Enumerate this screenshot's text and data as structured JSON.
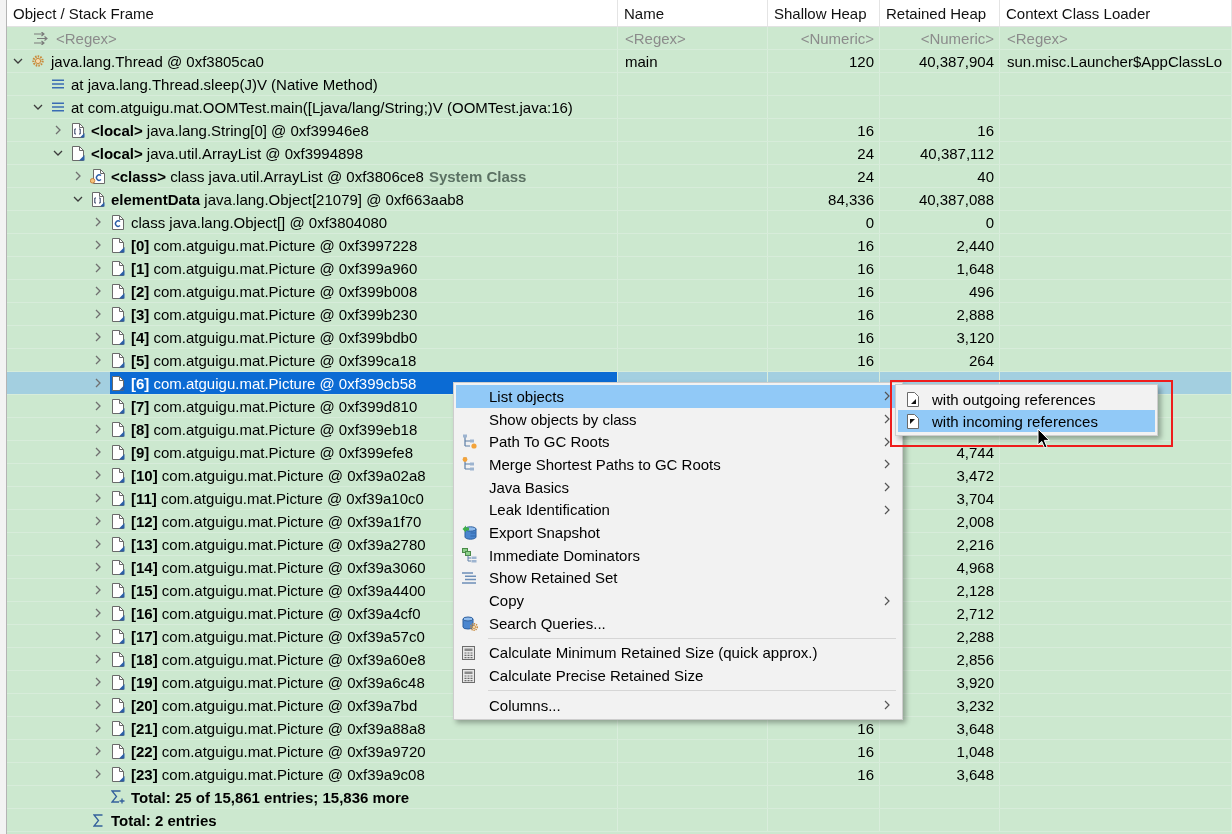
{
  "table": {
    "columns": [
      {
        "label": "Object / Stack Frame",
        "kind": "text",
        "filter": {
          "placeholder": "<Regex>"
        }
      },
      {
        "label": "Name",
        "kind": "text",
        "filter": {
          "placeholder": "<Regex>"
        }
      },
      {
        "label": "Shallow Heap",
        "kind": "numeric",
        "filter": {
          "placeholder": "<Numeric>"
        }
      },
      {
        "label": "Retained Heap",
        "kind": "numeric",
        "filter": {
          "placeholder": "<Numeric>"
        }
      },
      {
        "label": "Context Class Loader",
        "kind": "text",
        "filter": {
          "placeholder": "<Regex>"
        }
      }
    ],
    "rows": [
      {
        "kind": "thread",
        "text": "java.lang.Thread @ 0xf3805ca0",
        "name": "main",
        "shallow_heap": "120",
        "retained_heap": "40,387,904",
        "class_loader": "sun.misc.Launcher$AppClassLo",
        "expanded": true,
        "selected": false,
        "children": [
          {
            "kind": "frame",
            "text": "at java.lang.Thread.sleep(J)V (Native Method)",
            "selected": false
          },
          {
            "kind": "frame",
            "text": "at com.atguigu.mat.OOMTest.main([Ljava/lang/String;)V (OOMTest.java:16)",
            "expanded": true,
            "selected": false,
            "children": [
              {
                "kind": "array",
                "text": "**<local>** java.lang.String[0] @ 0xf39946e8",
                "shallow_heap": "16",
                "retained_heap": "16",
                "expanded": false,
                "selected": false
              },
              {
                "kind": "object",
                "text": "**<local>** java.util.ArrayList @ 0xf3994898",
                "shallow_heap": "24",
                "retained_heap": "40,387,112",
                "expanded": true,
                "selected": false,
                "children": [
                  {
                    "kind": "class_ref",
                    "text": "**<class>** class java.util.ArrayList @ 0xf3806ce8",
                    "note": "System Class",
                    "shallow_heap": "24",
                    "retained_heap": "40",
                    "expanded": false,
                    "selected": false
                  },
                  {
                    "kind": "array",
                    "text": "**elementData** java.lang.Object[21079] @ 0xf663aab8",
                    "shallow_heap": "84,336",
                    "retained_heap": "40,387,088",
                    "expanded": true,
                    "selected": false,
                    "children": [
                      {
                        "kind": "class",
                        "text": "class java.lang.Object[] @ 0xf3804080",
                        "shallow_heap": "0",
                        "retained_heap": "0",
                        "expanded": false,
                        "selected": false
                      },
                      {
                        "kind": "object",
                        "text": "**[0]** com.atguigu.mat.Picture @ 0xf3997228",
                        "shallow_heap": "16",
                        "retained_heap": "2,440",
                        "expanded": false,
                        "selected": false
                      },
                      {
                        "kind": "object",
                        "text": "**[1]** com.atguigu.mat.Picture @ 0xf399a960",
                        "shallow_heap": "16",
                        "retained_heap": "1,648",
                        "expanded": false,
                        "selected": false
                      },
                      {
                        "kind": "object",
                        "text": "**[2]** com.atguigu.mat.Picture @ 0xf399b008",
                        "shallow_heap": "16",
                        "retained_heap": "496",
                        "expanded": false,
                        "selected": false
                      },
                      {
                        "kind": "object",
                        "text": "**[3]** com.atguigu.mat.Picture @ 0xf399b230",
                        "shallow_heap": "16",
                        "retained_heap": "2,888",
                        "expanded": false,
                        "selected": false
                      },
                      {
                        "kind": "object",
                        "text": "**[4]** com.atguigu.mat.Picture @ 0xf399bdb0",
                        "shallow_heap": "16",
                        "retained_heap": "3,120",
                        "expanded": false,
                        "selected": false
                      },
                      {
                        "kind": "object",
                        "text": "**[5]** com.atguigu.mat.Picture @ 0xf399ca18",
                        "shallow_heap": "16",
                        "retained_heap": "264",
                        "expanded": false,
                        "selected": false
                      },
                      {
                        "kind": "object",
                        "text": "**[6]** com.atguigu.mat.Picture @ 0xf399cb58",
                        "expanded": false,
                        "selected": true
                      },
                      {
                        "kind": "object",
                        "text": "**[7]** com.atguigu.mat.Picture @ 0xf399d810",
                        "expanded": false,
                        "selected": false
                      },
                      {
                        "kind": "object",
                        "text": "**[8]** com.atguigu.mat.Picture @ 0xf399eb18",
                        "expanded": false,
                        "selected": false
                      },
                      {
                        "kind": "object",
                        "text": "**[9]** com.atguigu.mat.Picture @ 0xf399efe8",
                        "retained_heap": "4,744",
                        "expanded": false,
                        "selected": false
                      },
                      {
                        "kind": "object",
                        "text": "**[10]** com.atguigu.mat.Picture @ 0xf39a02a8",
                        "retained_heap": "3,472",
                        "expanded": false,
                        "selected": false
                      },
                      {
                        "kind": "object",
                        "text": "**[11]** com.atguigu.mat.Picture @ 0xf39a10c0",
                        "retained_heap": "3,704",
                        "expanded": false,
                        "selected": false
                      },
                      {
                        "kind": "object",
                        "text": "**[12]** com.atguigu.mat.Picture @ 0xf39a1f70",
                        "retained_heap": "2,008",
                        "expanded": false,
                        "selected": false
                      },
                      {
                        "kind": "object",
                        "text": "**[13]** com.atguigu.mat.Picture @ 0xf39a2780",
                        "retained_heap": "2,216",
                        "expanded": false,
                        "selected": false
                      },
                      {
                        "kind": "object",
                        "text": "**[14]** com.atguigu.mat.Picture @ 0xf39a3060",
                        "retained_heap": "4,968",
                        "expanded": false,
                        "selected": false
                      },
                      {
                        "kind": "object",
                        "text": "**[15]** com.atguigu.mat.Picture @ 0xf39a4400",
                        "retained_heap": "2,128",
                        "expanded": false,
                        "selected": false
                      },
                      {
                        "kind": "object",
                        "text": "**[16]** com.atguigu.mat.Picture @ 0xf39a4cf0",
                        "retained_heap": "2,712",
                        "expanded": false,
                        "selected": false
                      },
                      {
                        "kind": "object",
                        "text": "**[17]** com.atguigu.mat.Picture @ 0xf39a57c0",
                        "retained_heap": "2,288",
                        "expanded": false,
                        "selected": false
                      },
                      {
                        "kind": "object",
                        "text": "**[18]** com.atguigu.mat.Picture @ 0xf39a60e8",
                        "retained_heap": "2,856",
                        "expanded": false,
                        "selected": false
                      },
                      {
                        "kind": "object",
                        "text": "**[19]** com.atguigu.mat.Picture @ 0xf39a6c48",
                        "retained_heap": "3,920",
                        "expanded": false,
                        "selected": false
                      },
                      {
                        "kind": "object",
                        "text": "**[20]** com.atguigu.mat.Picture @ 0xf39a7bd",
                        "retained_heap": "3,232",
                        "expanded": false,
                        "selected": false
                      },
                      {
                        "kind": "object",
                        "text": "**[21]** com.atguigu.mat.Picture @ 0xf39a88a8",
                        "shallow_heap": "16",
                        "retained_heap": "3,648",
                        "expanded": false,
                        "selected": false
                      },
                      {
                        "kind": "object",
                        "text": "**[22]** com.atguigu.mat.Picture @ 0xf39a9720",
                        "shallow_heap": "16",
                        "retained_heap": "1,048",
                        "expanded": false,
                        "selected": false
                      },
                      {
                        "kind": "object",
                        "text": "**[23]** com.atguigu.mat.Picture @ 0xf39a9c08",
                        "shallow_heap": "16",
                        "retained_heap": "3,648",
                        "expanded": false,
                        "selected": false
                      },
                      {
                        "kind": "total_more",
                        "text": "Total: 25 of 15,861 entries; 15,836 more",
                        "selected": false
                      }
                    ]
                  },
                  {
                    "kind": "total",
                    "text": "Total: 2 entries",
                    "selected": false
                  }
                ]
              }
            ]
          }
        ]
      }
    ]
  },
  "context_menu": {
    "groups": [
      {
        "items": [
          {
            "label": "List objects",
            "kind": "plain",
            "submenu": true,
            "selected": true
          },
          {
            "label": "Show objects by class",
            "kind": "plain",
            "submenu": true,
            "selected": false
          },
          {
            "label": "Path To GC Roots",
            "kind": "path",
            "submenu": true,
            "selected": false
          },
          {
            "label": "Merge Shortest Paths to GC Roots",
            "kind": "merge",
            "submenu": true,
            "selected": false
          },
          {
            "label": "Java Basics",
            "kind": "plain",
            "submenu": true,
            "selected": false
          },
          {
            "label": "Leak Identification",
            "kind": "plain",
            "submenu": true,
            "selected": false
          },
          {
            "label": "Export Snapshot",
            "kind": "export",
            "submenu": false,
            "selected": false
          },
          {
            "label": "Immediate Dominators",
            "kind": "dominators",
            "submenu": false,
            "selected": false
          },
          {
            "label": "Show Retained Set",
            "kind": "retained",
            "submenu": false,
            "selected": false
          },
          {
            "label": "Copy",
            "kind": "plain",
            "submenu": true,
            "selected": false
          },
          {
            "label": "Search Queries...",
            "kind": "queries",
            "submenu": false,
            "selected": false
          }
        ]
      },
      {
        "items": [
          {
            "label": "Calculate Minimum Retained Size (quick approx.)",
            "kind": "calculator",
            "submenu": false,
            "selected": false
          },
          {
            "label": "Calculate Precise Retained Size",
            "kind": "calculator",
            "submenu": false,
            "selected": false
          }
        ]
      },
      {
        "items": [
          {
            "label": "Columns...",
            "kind": "plain",
            "submenu": true,
            "selected": false
          }
        ]
      }
    ]
  },
  "submenu": {
    "items": [
      {
        "label": "with outgoing references",
        "kind": "outgoing",
        "selected": false
      },
      {
        "label": "with incoming references",
        "kind": "incoming",
        "selected": true
      }
    ]
  }
}
